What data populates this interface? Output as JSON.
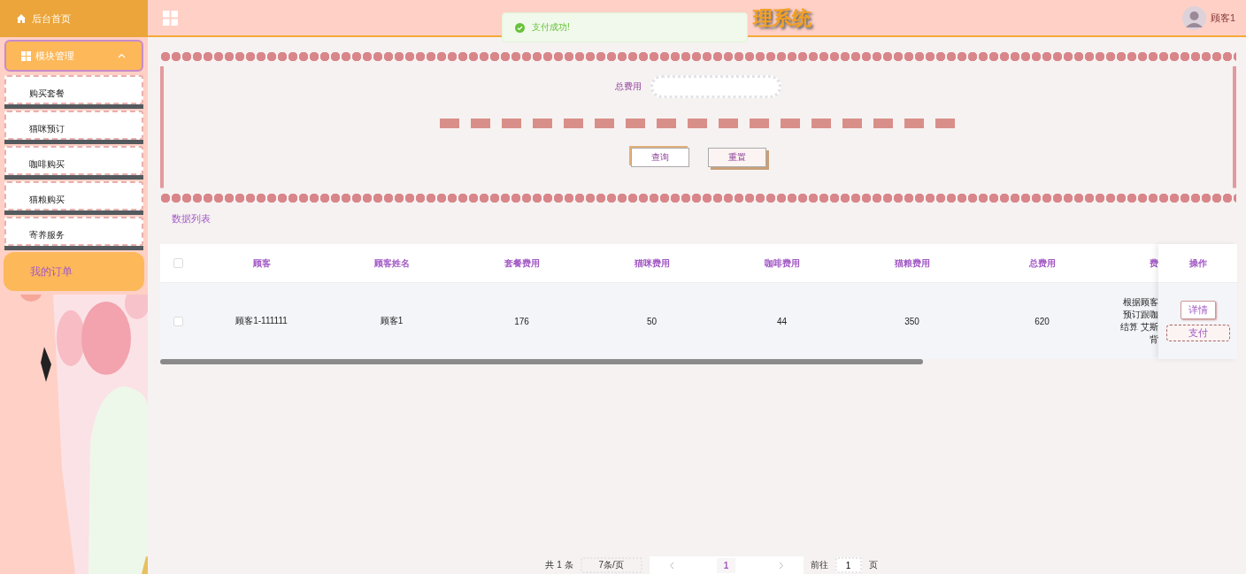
{
  "sidebar": {
    "home": "后台首页",
    "group": {
      "label": "模块管理",
      "expanded": true,
      "children": [
        {
          "label": "购买套餐",
          "selected": false
        },
        {
          "label": "猫咪预订",
          "selected": false
        },
        {
          "label": "咖啡购买",
          "selected": false
        },
        {
          "label": "猫粮购买",
          "selected": false
        },
        {
          "label": "寄养服务",
          "selected": false
        }
      ]
    },
    "orders": "我的订单"
  },
  "header": {
    "title": "理系统",
    "user": "顾客1"
  },
  "toast": {
    "kind": "success",
    "message": "支付成功!"
  },
  "search": {
    "label": "总费用",
    "buttons": [
      "查询",
      "重置"
    ]
  },
  "table": {
    "title": "数据列表",
    "select_all": {
      "checked": false
    },
    "columns": [
      "顾客",
      "顾客姓名",
      "套餐费用",
      "猫咪费用",
      "咖啡费用",
      "猫粮费用",
      "总费用",
      "费"
    ],
    "action_column": "操作",
    "rows": [
      {
        "checked": false,
        "cells": [
          "顾客1-111111",
          "顾客1",
          "176",
          "50",
          "44",
          "350",
          "620"
        ],
        "column_8": [
          "根据顾客",
          "预订跟咖",
          "结算 艾斯",
          "背"
        ],
        "actions": [
          "详情",
          "支付"
        ]
      }
    ]
  },
  "pagination": {
    "total": "共 1 条",
    "page_size": "7条/页",
    "pages": [
      {
        "label": "1",
        "selected": true
      }
    ],
    "goto_label": "前往",
    "goto_value": "1",
    "goto_suffix": "页"
  }
}
